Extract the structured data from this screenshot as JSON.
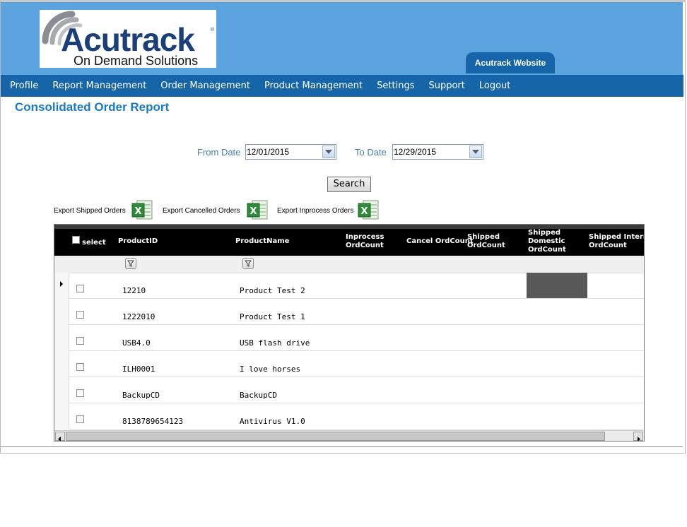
{
  "header": {
    "logo_text": "Acutrack",
    "logo_tagline": "On Demand Solutions",
    "website_tab": "Acutrack Website"
  },
  "nav": {
    "items": [
      "Profile",
      "Report Management",
      "Order Management",
      "Product Management",
      "Settings",
      "Support",
      "Logout"
    ]
  },
  "page": {
    "title": "Consolidated Order Report"
  },
  "filters": {
    "from_label": "From Date",
    "from_value": "12/01/2015",
    "to_label": "To Date",
    "to_value": "12/29/2015",
    "search_label": "Search"
  },
  "exports": {
    "shipped": "Export Shipped Orders",
    "cancelled": "Export Cancelled Orders",
    "inprocess": "Export Inprocess Orders"
  },
  "grid": {
    "columns": {
      "select": "select",
      "product_id": "ProductID",
      "product_name": "ProductName",
      "inprocess": [
        "Inprocess",
        "OrdCount"
      ],
      "cancel": [
        "Cancel OrdCount"
      ],
      "shipped": [
        "Shipped",
        "OrdCount"
      ],
      "shipped_domestic": [
        "Shipped",
        "Domestic",
        "OrdCount"
      ],
      "shipped_international": [
        "Shipped International",
        "OrdCount"
      ]
    },
    "rows": [
      {
        "id": "12210",
        "name": "Product Test 2"
      },
      {
        "id": "1222010",
        "name": "Product Test 1"
      },
      {
        "id": "USB4.0",
        "name": "USB flash drive"
      },
      {
        "id": "ILH0001",
        "name": "I love horses"
      },
      {
        "id": "BackupCD",
        "name": "BackupCD"
      },
      {
        "id": "8138789654123",
        "name": "Antivirus V1.0"
      }
    ]
  },
  "colors": {
    "header_bg": "#5ba3de",
    "nav_bg": "#1565a8",
    "title_color": "#1d7ac4",
    "grid_header_bg": "#000000"
  }
}
